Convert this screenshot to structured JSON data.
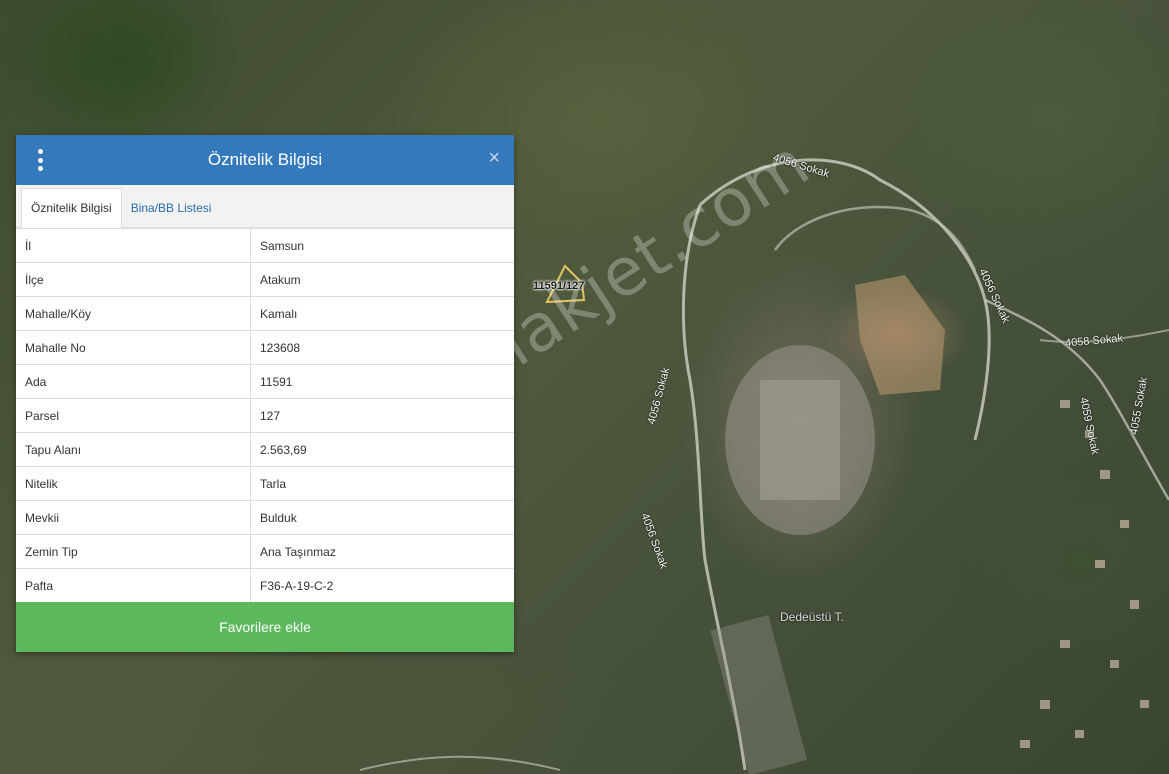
{
  "panel": {
    "title": "Öznitelik Bilgisi",
    "menu_icon": "vertical-ellipsis-icon",
    "close_icon": "close-icon",
    "close_symbol": "×",
    "tabs": [
      {
        "label": "Öznitelik Bilgisi",
        "active": true
      },
      {
        "label": "Bina/BB Listesi",
        "active": false
      }
    ],
    "rows": [
      {
        "key": "İl",
        "value": "Samsun"
      },
      {
        "key": "İlçe",
        "value": "Atakum"
      },
      {
        "key": "Mahalle/Köy",
        "value": "Kamalı"
      },
      {
        "key": "Mahalle No",
        "value": "123608"
      },
      {
        "key": "Ada",
        "value": "11591"
      },
      {
        "key": "Parsel",
        "value": "127"
      },
      {
        "key": "Tapu Alanı",
        "value": "2.563,69"
      },
      {
        "key": "Nitelik",
        "value": "Tarla"
      },
      {
        "key": "Mevkii",
        "value": "Bulduk"
      },
      {
        "key": "Zemin Tip",
        "value": "Ana Taşınmaz"
      },
      {
        "key": "Pafta",
        "value": "F36-A-19-C-2"
      }
    ],
    "favorite_button": "Favorilere ekle"
  },
  "map": {
    "parcel_label": "11591/127",
    "watermark": "emlakjet.com",
    "place_labels": {
      "street_4056_top": "4056 Sokak",
      "street_4056_right": "4056 Sokak",
      "street_4056_left": "4056 Sokak",
      "street_4056_bottom": "4056 Sokak",
      "street_4058": "4058 Sokak",
      "street_4059": "4059 Sokak",
      "street_4055": "4055 Sokak",
      "hill": "Dedeüstü T."
    }
  },
  "colors": {
    "header": "#3579bd",
    "favorite_button": "#5cb85c",
    "active_tab_text": "#333333",
    "inactive_tab_text": "#2a6db0",
    "parcel_outline": "#e0c060"
  }
}
